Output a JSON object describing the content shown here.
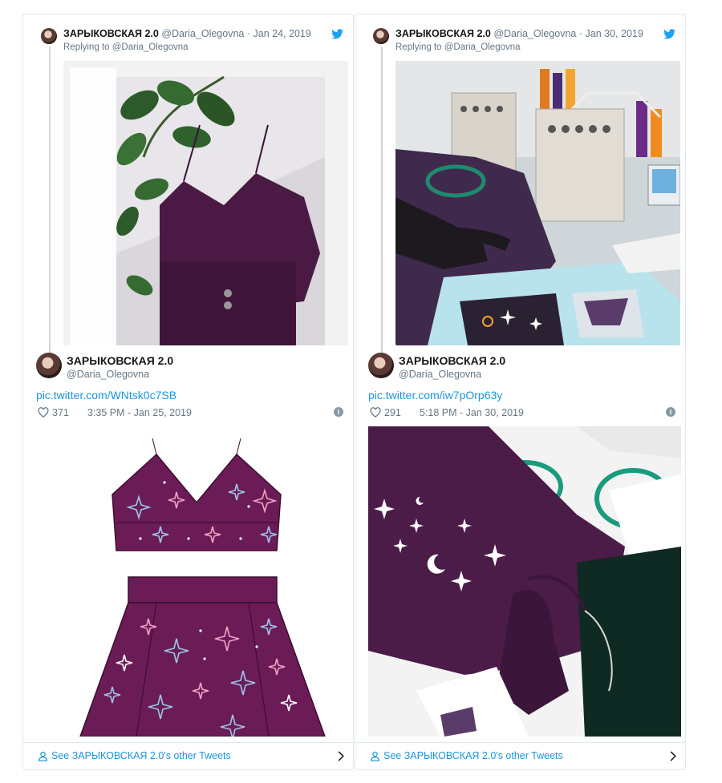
{
  "colors": {
    "link": "#1b95e0",
    "muted": "#657786",
    "border": "#e1e8ed",
    "garment_purple": "#6b1c56",
    "twitter_blue": "#1da1f2"
  },
  "tweets": [
    {
      "reply_author_name": "ЗАРЫКОВСКАЯ 2.0",
      "reply_handle": "@Daria_Olegovna",
      "reply_date": "Jan 24, 2019",
      "replying_to_prefix": "Replying to",
      "replying_to_handle": "@Daria_Olegovna",
      "author_name": "ЗАРЫКОВСКАЯ 2.0",
      "author_handle": "@Daria_Olegovna",
      "link_text": "pic.twitter.com/WNtsk0c7SB",
      "likes": "371",
      "timestamp": "3:35 PM - Jan 25, 2019",
      "footer_text": "See ЗАРЫКОВСКАЯ 2.0's other Tweets",
      "icons": [
        "twitter-bird-icon",
        "heart-icon",
        "info-icon",
        "person-icon",
        "chevron-right-icon"
      ]
    },
    {
      "reply_author_name": "ЗАРЫКОВСКАЯ 2.0",
      "reply_handle": "@Daria_Olegovna",
      "reply_date": "Jan 30, 2019",
      "replying_to_prefix": "Replying to",
      "replying_to_handle": "@Daria_Olegovna",
      "author_name": "ЗАРЫКОВСКАЯ 2.0",
      "author_handle": "@Daria_Olegovna",
      "link_text": "pic.twitter.com/iw7pOrp63y",
      "likes": "291",
      "timestamp": "5:18 PM - Jan 30, 2019",
      "footer_text": "See ЗАРЫКОВСКАЯ 2.0's other Tweets",
      "icons": [
        "twitter-bird-icon",
        "heart-icon",
        "info-icon",
        "person-icon",
        "chevron-right-icon"
      ]
    }
  ]
}
